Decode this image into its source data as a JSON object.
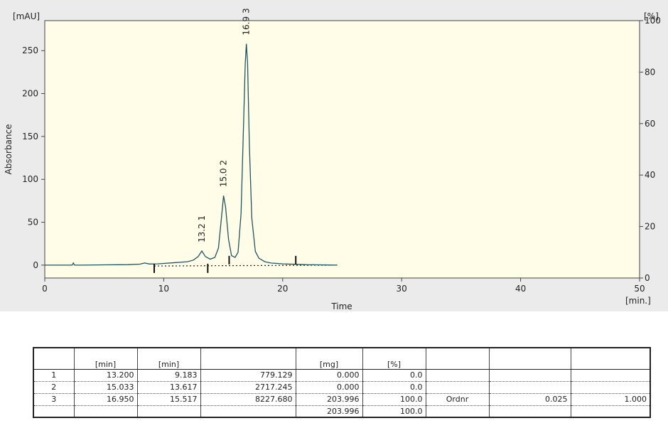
{
  "chart_data": {
    "type": "line",
    "x_unit": "[min.]",
    "xlabel": "Time",
    "ylabel": "Absorbance",
    "y_unit": "[mAU]",
    "y2_unit": "[%]",
    "xlim": [
      0,
      50
    ],
    "ylim": [
      -15,
      285
    ],
    "y2lim": [
      0,
      100
    ],
    "x_ticks": [
      0,
      10,
      20,
      30,
      40,
      50
    ],
    "y_ticks": [
      0,
      50,
      100,
      150,
      200,
      250
    ],
    "y2_ticks": [
      0,
      20,
      40,
      60,
      80,
      100
    ],
    "grid": false,
    "series": [
      {
        "x": [
          0,
          2.3,
          2.4,
          2.5,
          3,
          5,
          7,
          8,
          8.4,
          8.8,
          9.5,
          10,
          11,
          12,
          12.5,
          12.9,
          13.2,
          13.5,
          13.9,
          14.3,
          14.6,
          14.85,
          15.03,
          15.2,
          15.45,
          15.7,
          16.0,
          16.25,
          16.5,
          16.7,
          16.85,
          16.95,
          17.05,
          17.2,
          17.4,
          17.7,
          18.0,
          18.5,
          19,
          20,
          21,
          22,
          23,
          24,
          24.6
        ],
        "y": [
          0,
          0,
          2.5,
          0,
          0,
          0.3,
          0.6,
          1.2,
          2.5,
          1.3,
          1.5,
          2,
          3,
          4,
          6,
          10,
          16.5,
          10,
          7,
          9,
          20,
          55,
          81,
          68,
          30,
          11,
          9,
          15,
          60,
          160,
          235,
          258,
          235,
          140,
          55,
          16,
          8,
          4,
          2.5,
          1.5,
          1,
          0.5,
          0.3,
          0.1,
          0
        ]
      }
    ],
    "baseline": {
      "x": [
        9.2,
        24.6
      ],
      "y": [
        -1,
        0
      ]
    },
    "peak_labels": [
      {
        "id": "1",
        "time": "13.2",
        "x": 13.2,
        "y": 16.5
      },
      {
        "id": "2",
        "time": "15.0",
        "x": 15.03,
        "y": 81
      },
      {
        "id": "3",
        "time": "16.9",
        "x": 16.95,
        "y": 258
      }
    ],
    "integration_marks": [
      {
        "x": 9.2,
        "dir": "down"
      },
      {
        "x": 13.7,
        "dir": "down"
      },
      {
        "x": 15.5,
        "dir": "up"
      },
      {
        "x": 21.1,
        "dir": "up"
      }
    ]
  },
  "table": {
    "headers": [
      "",
      "[min]",
      "[min]",
      "",
      "[mg]",
      "[%]",
      "",
      "",
      ""
    ],
    "rows": [
      [
        "1",
        "13.200",
        "9.183",
        "779.129",
        "0.000",
        "0.0",
        "",
        "",
        ""
      ],
      [
        "2",
        "15.033",
        "13.617",
        "2717.245",
        "0.000",
        "0.0",
        "",
        "",
        ""
      ],
      [
        "3",
        "16.950",
        "15.517",
        "8227.680",
        "203.996",
        "100.0",
        "Ordnr",
        "0.025",
        "1.000"
      ],
      [
        "",
        "",
        "",
        "",
        "203.996",
        "100.0",
        "",
        "",
        ""
      ]
    ]
  },
  "colors": {
    "plot_bg": "#fffde8",
    "trace": "#1f5561",
    "panel_bg": "#ebebeb"
  }
}
